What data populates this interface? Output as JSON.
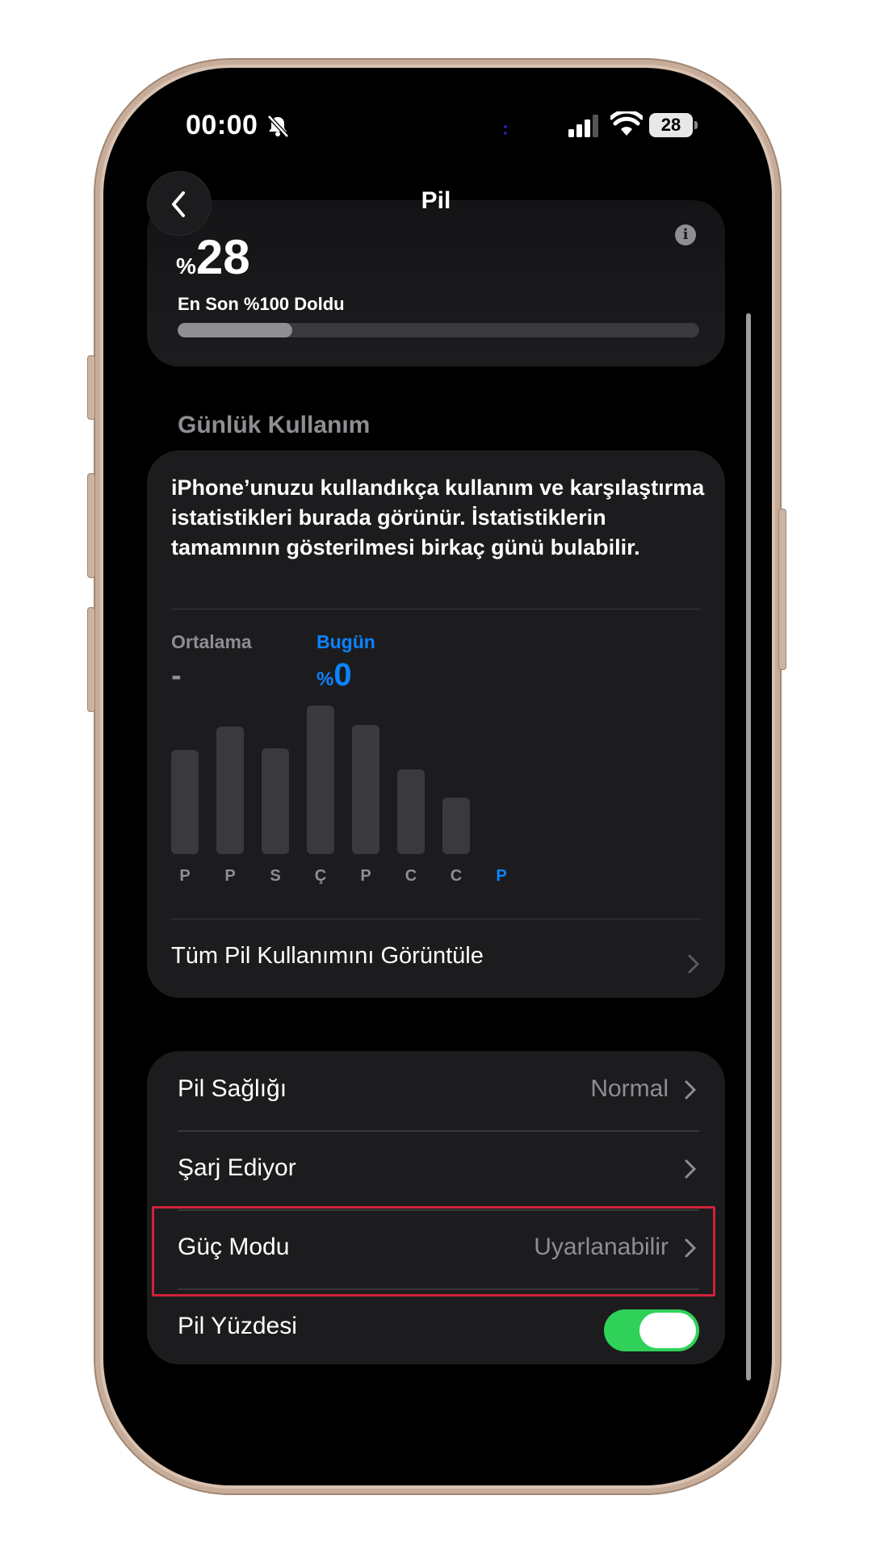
{
  "status_bar": {
    "time": "00:00",
    "battery": "28"
  },
  "nav": {
    "title": "Pil"
  },
  "charge": {
    "percent_sign": "%",
    "percent_value": "28",
    "last_charged": "En Son %100 Doldu",
    "bar_level": 0.22
  },
  "daily_usage": {
    "header": "Günlük Kullanım",
    "description": "iPhone’unuzu kullandıkça kullanım ve karşılaştırma istatistikleri burada görünür. İstatistiklerin tamamının gösterilmesi birkaç günü bulabilir.",
    "average_label": "Ortalama",
    "average_value": "-",
    "today_label": "Bugün",
    "today_percent_sign": "%",
    "today_value": "0",
    "view_all": "Tüm Pil Kullanımını Görüntüle"
  },
  "chart_data": {
    "type": "bar",
    "categories": [
      "P",
      "P",
      "S",
      "Ç",
      "P",
      "C",
      "C",
      "P"
    ],
    "values": [
      0.7,
      0.86,
      0.71,
      1.0,
      0.87,
      0.57,
      0.38,
      0
    ],
    "active_index": 7,
    "title": "",
    "xlabel": "",
    "ylabel": ""
  },
  "settings": {
    "items": [
      {
        "label": "Pil Sağlığı",
        "value": "Normal"
      },
      {
        "label": "Şarj Ediyor",
        "value": ""
      },
      {
        "label": "Güç Modu",
        "value": "Uyarlanabilir"
      },
      {
        "label": "Pil Yüzdesi",
        "toggle_on": true
      }
    ]
  },
  "colors": {
    "accent": "#0a84ff",
    "toggle_on": "#30d158",
    "highlight": "#d0213a"
  }
}
